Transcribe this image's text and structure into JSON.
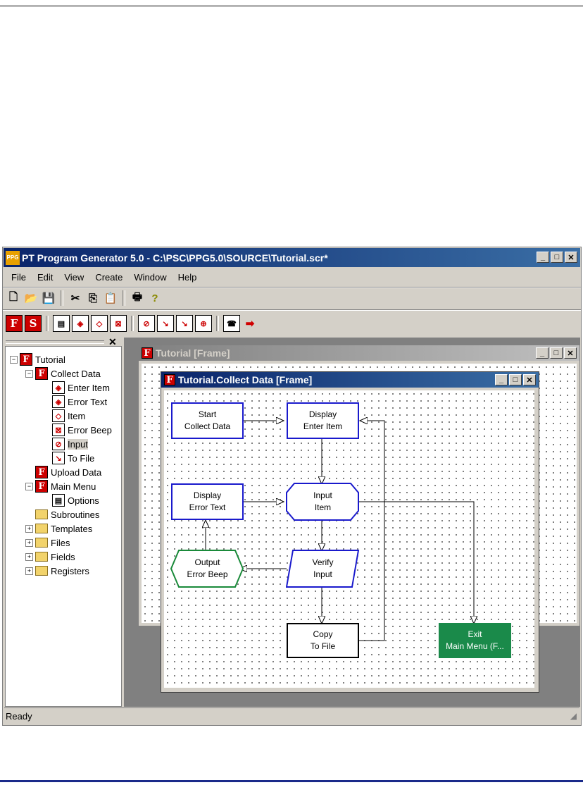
{
  "window": {
    "title": "PT Program Generator 5.0 - C:\\PSC\\PPG5.0\\SOURCE\\Tutorial.scr*",
    "app_icon": "PPG"
  },
  "menu": [
    "File",
    "Edit",
    "View",
    "Create",
    "Window",
    "Help"
  ],
  "toolbar1": [
    "new-file-icon",
    "open-folder-icon",
    "save-icon",
    "cut-icon",
    "copy-icon",
    "paste-icon",
    "print-icon",
    "help-icon"
  ],
  "toolbar2": [
    "frame-F-icon",
    "subroutine-S-icon",
    "display-icon",
    "error-text-icon",
    "item-icon",
    "error-beep-icon",
    "input-icon",
    "to-file-a-icon",
    "to-file-b-icon",
    "output-icon",
    "phone-icon",
    "exit-arrow-icon"
  ],
  "tree": {
    "items": [
      {
        "label": "Tutorial"
      },
      {
        "label": "Collect Data"
      },
      {
        "label": "Enter Item"
      },
      {
        "label": "Error Text"
      },
      {
        "label": "Item"
      },
      {
        "label": "Error Beep"
      },
      {
        "label": "Input"
      },
      {
        "label": "To File"
      },
      {
        "label": "Upload Data"
      },
      {
        "label": "Main Menu"
      },
      {
        "label": "Options"
      },
      {
        "label": "Subroutines"
      },
      {
        "label": "Templates"
      },
      {
        "label": "Files"
      },
      {
        "label": "Fields"
      },
      {
        "label": "Registers"
      }
    ]
  },
  "outer_frame": {
    "title": "Tutorial [Frame]"
  },
  "inner_frame": {
    "title": "Tutorial.Collect Data [Frame]"
  },
  "nodes": {
    "start": "Start\nCollect Data",
    "display_enter": "Display\nEnter Item",
    "display_error": "Display\nError Text",
    "input_item": "Input\nItem",
    "output_beep": "Output\nError Beep",
    "verify": "Verify\nInput",
    "copy": "Copy\nTo File",
    "exit": "Exit\nMain Menu (F..."
  },
  "colors": {
    "node_border": "#1a1acc",
    "output_border": "#1a8a3a",
    "exit_fill": "#1a8a4a"
  },
  "status": "Ready"
}
